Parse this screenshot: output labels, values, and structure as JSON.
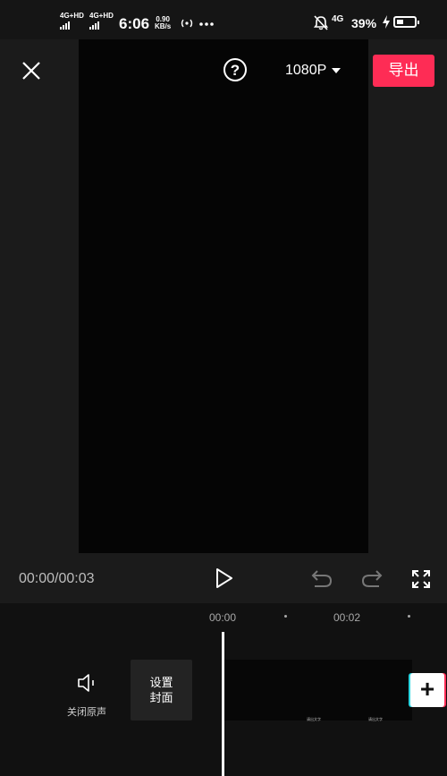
{
  "status_bar": {
    "sim1": "4G+HD",
    "sim2": "4G+HD",
    "time": "6:06",
    "speed_value": "0.90",
    "speed_unit": "KB/s",
    "network": "4G",
    "battery": "39%",
    "battery_level": 0.39
  },
  "top_bar": {
    "resolution": "1080P",
    "export_label": "导出",
    "help_symbol": "?"
  },
  "player": {
    "timecode": "00:00/00:03"
  },
  "timeline": {
    "ticks": [
      "00:00",
      "00:02"
    ],
    "mute_label": "关闭原声",
    "cover_line1": "设置",
    "cover_line2": "封面",
    "clip_texts": [
      "请出文字",
      "请出文字"
    ],
    "add_symbol": "+"
  },
  "colors": {
    "accent": "#fe2c55",
    "cyan": "#2bd5e0",
    "background": "#1b1b1b"
  }
}
